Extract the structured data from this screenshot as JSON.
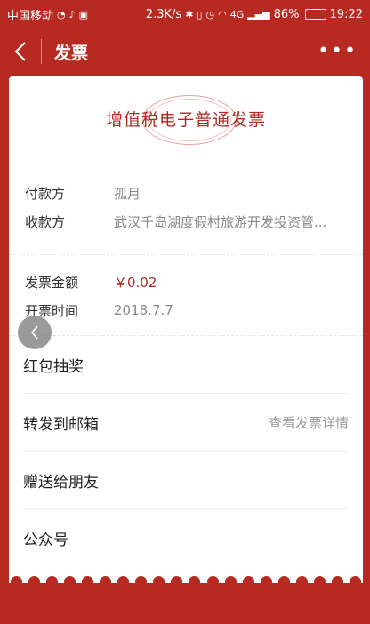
{
  "status_bar": {
    "carrier": "中国移动",
    "speed": "2.3K/s",
    "network": "4G",
    "battery": "86%",
    "battery_level": 0.86,
    "time": "19:22"
  },
  "nav": {
    "title": "发票"
  },
  "invoice": {
    "title": "增值税电子普通发票",
    "payer_label": "付款方",
    "payer_value": "孤月",
    "payee_label": "收款方",
    "payee_value": "武汉千岛湖度假村旅游开发投资管...",
    "amount_label": "发票金额",
    "amount_value": "￥0.02",
    "date_label": "开票时间",
    "date_value": "2018.7.7"
  },
  "menu": {
    "items": [
      {
        "label": "红包抽奖",
        "right": ""
      },
      {
        "label": "转发到邮箱",
        "right": "查看发票详情"
      },
      {
        "label": "赠送给朋友",
        "right": ""
      },
      {
        "label": "公众号",
        "right": ""
      }
    ]
  },
  "colors": {
    "brand_red": "#b72a22",
    "accent_red": "#b02a22"
  }
}
